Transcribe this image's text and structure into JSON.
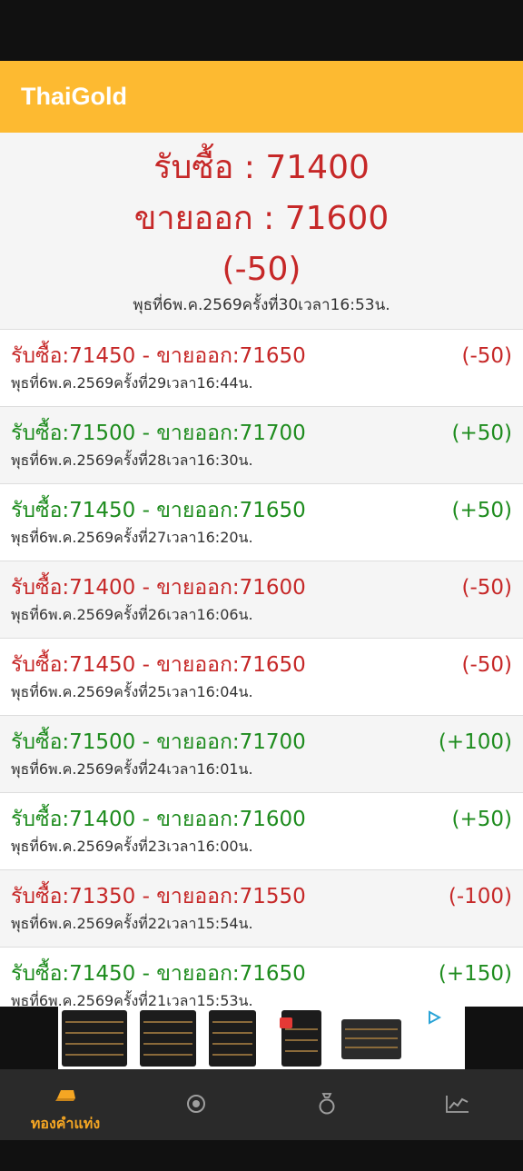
{
  "app": {
    "title": "ThaiGold"
  },
  "latest": {
    "buy_line": "รับซื้อ : 71400",
    "sell_line": "ขายออก : 71600",
    "change": "(-50)",
    "timestamp": "พุธที่6พ.ค.2569ครั้งที่30เวลา16:53น."
  },
  "history": [
    {
      "price": "รับซื้อ:71450 - ขายออก:71650",
      "change": "(-50)",
      "time": "พุธที่6พ.ค.2569ครั้งที่29เวลา16:44น.",
      "trend": "down"
    },
    {
      "price": "รับซื้อ:71500 - ขายออก:71700",
      "change": "(+50)",
      "time": "พุธที่6พ.ค.2569ครั้งที่28เวลา16:30น.",
      "trend": "up"
    },
    {
      "price": "รับซื้อ:71450 - ขายออก:71650",
      "change": "(+50)",
      "time": "พุธที่6พ.ค.2569ครั้งที่27เวลา16:20น.",
      "trend": "up"
    },
    {
      "price": "รับซื้อ:71400 - ขายออก:71600",
      "change": "(-50)",
      "time": "พุธที่6พ.ค.2569ครั้งที่26เวลา16:06น.",
      "trend": "down"
    },
    {
      "price": "รับซื้อ:71450 - ขายออก:71650",
      "change": "(-50)",
      "time": "พุธที่6พ.ค.2569ครั้งที่25เวลา16:04น.",
      "trend": "down"
    },
    {
      "price": "รับซื้อ:71500 - ขายออก:71700",
      "change": "(+100)",
      "time": "พุธที่6พ.ค.2569ครั้งที่24เวลา16:01น.",
      "trend": "up"
    },
    {
      "price": "รับซื้อ:71400 - ขายออก:71600",
      "change": "(+50)",
      "time": "พุธที่6พ.ค.2569ครั้งที่23เวลา16:00น.",
      "trend": "up"
    },
    {
      "price": "รับซื้อ:71350 - ขายออก:71550",
      "change": "(-100)",
      "time": "พุธที่6พ.ค.2569ครั้งที่22เวลา15:54น.",
      "trend": "down"
    },
    {
      "price": "รับซื้อ:71450 - ขายออก:71650",
      "change": "(+150)",
      "time": "พุธที่6พ.ค.2569ครั้งที่21เวลา15:53น.",
      "trend": "up"
    }
  ],
  "ad": {
    "icon": "ad-choices-icon"
  },
  "nav": {
    "items": [
      {
        "label": "ทองคำแท่ง",
        "icon": "gold-bar-icon",
        "active": true
      },
      {
        "label": "",
        "icon": "target-icon",
        "active": false
      },
      {
        "label": "",
        "icon": "ring-icon",
        "active": false
      },
      {
        "label": "",
        "icon": "chart-icon",
        "active": false
      }
    ]
  },
  "colors": {
    "accent": "#FDBA31",
    "down": "#C62828",
    "up": "#1E8C1E",
    "nav_active": "#F5A623"
  }
}
